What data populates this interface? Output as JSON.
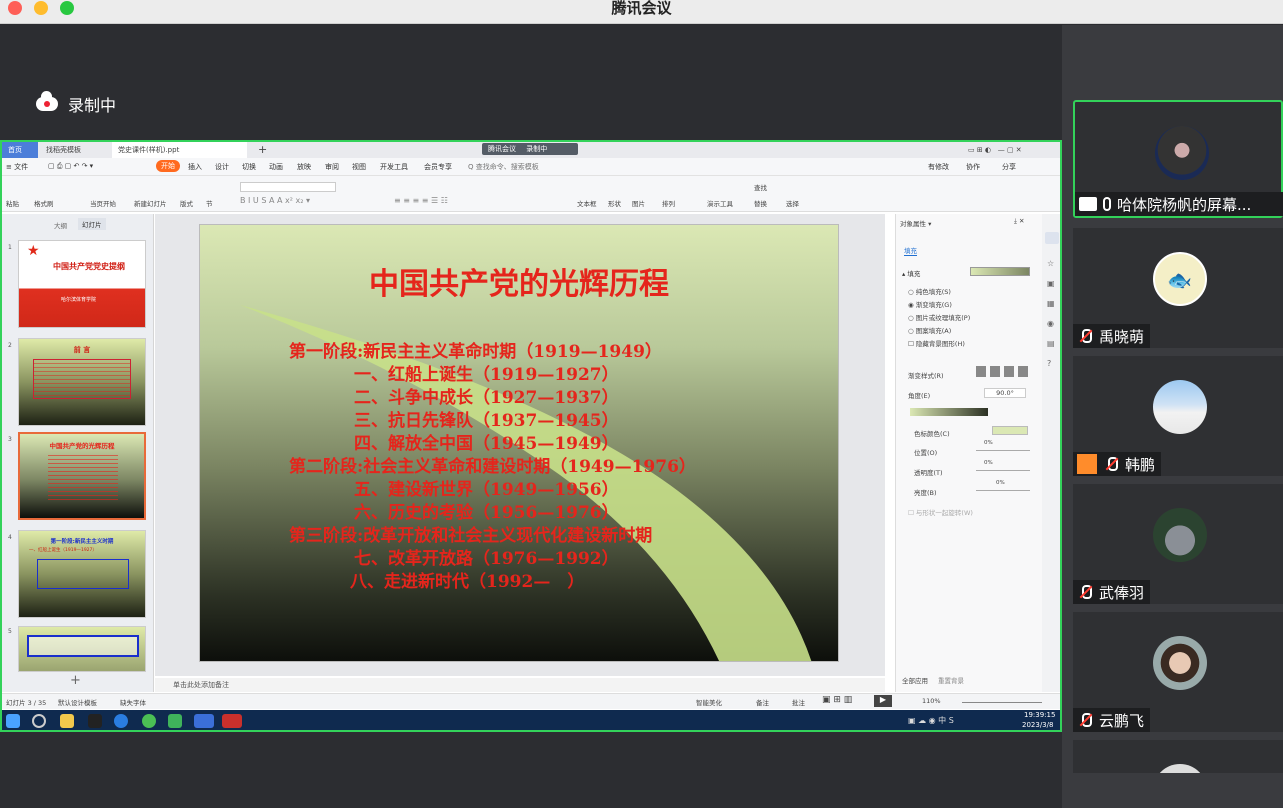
{
  "window": {
    "title": "腾讯会议"
  },
  "recording": {
    "label": "录制中"
  },
  "wps": {
    "tabs": [
      "首页",
      "找稻壳模板",
      "党史课件(样机).ppt"
    ],
    "meeting_badge": "腾讯会议",
    "recording_badge": "录制中",
    "menu": [
      "≡ 文件",
      "开始",
      "插入",
      "设计",
      "切换",
      "动画",
      "放映",
      "审阅",
      "视图",
      "开发工具",
      "会员专享",
      "Q 查找命令、搜索模板"
    ],
    "menu_right": [
      "有修改",
      "协作",
      "分享"
    ],
    "ribbon": [
      "粘贴",
      "格式刷",
      "当页开始",
      "新建幻灯片",
      "版式",
      "节",
      "文本框",
      "形状",
      "图片",
      "排列",
      "演示工具",
      "查找",
      "替换",
      "选择"
    ],
    "panel_tabs": [
      "大纲",
      "幻灯片"
    ],
    "thumbs": [
      {
        "num": "1",
        "title": "中国共产党党史提纲",
        "sub": "哈尔滨体育学院"
      },
      {
        "num": "2",
        "title": "前 言",
        "sub": ""
      },
      {
        "num": "3",
        "title": "中国共产党的光辉历程",
        "sub": ""
      },
      {
        "num": "4",
        "title": "第一阶段:新民主主义时期",
        "sub": "一、红船上诞生（1919—1927）"
      },
      {
        "num": "5",
        "title": "",
        "sub": ""
      }
    ],
    "slide": {
      "title": "中国共产党的光辉历程",
      "lines": [
        "第一阶段:新民主主义革命时期（1919—1949）",
        "一、红船上诞生（1919—1927）",
        "二、斗争中成长（1927—1937）",
        "三、抗日先锋队（1937—1945）",
        "四、解放全中国（1945—1949）",
        "第二阶段:社会主义革命和建设时期（1949—1976）",
        "五、建设新世界（1949—1956）",
        "六、历史的考验（1956—1976）",
        "第三阶段:改革开放和社会主义现代化建设新时期",
        "七、改革开放路（1976—1992）",
        "八、走进新时代（1992—　）"
      ]
    },
    "props": {
      "header": "对象属性 ▾",
      "tab": "填充",
      "section": "▴ 填充",
      "options": [
        "纯色填充(S)",
        "渐变填充(G)",
        "图片或纹理填充(P)",
        "图案填充(A)",
        "隐藏背景图形(H)"
      ],
      "gradient_style": "渐变样式(R)",
      "angle_label": "角度(E)",
      "angle_value": "90.0°",
      "stop_color": "色标颜色(C)",
      "position": "位置(O)",
      "transparency": "透明度(T)",
      "brightness": "亮度(B)",
      "pct": "0%",
      "apply_rotate": "与形状一起旋转(W)",
      "apply_all": "全部应用",
      "reset": "重置背景"
    },
    "notes": "单击此处添加备注",
    "status": {
      "slide": "幻灯片 3 / 35",
      "template": "默认设计模板",
      "font": "缺失字体",
      "beautify": "智能美化",
      "notes": "备注",
      "comment": "批注",
      "zoom": "110%"
    },
    "clock": {
      "time": "19:39:15",
      "date": "2023/3/8"
    }
  },
  "participants": [
    {
      "name": "哈体院杨帆的屏幕...",
      "active": true,
      "sharing": true
    },
    {
      "name": "禹晓萌",
      "muted": true
    },
    {
      "name": "韩鹏",
      "muted": true
    },
    {
      "name": "武俸羽",
      "muted": true
    },
    {
      "name": "云鹏飞",
      "muted": true
    }
  ],
  "colors": {
    "accent": "#33d25a",
    "slide_red": "#e5251c",
    "wps_orange": "#ff6a1f"
  }
}
